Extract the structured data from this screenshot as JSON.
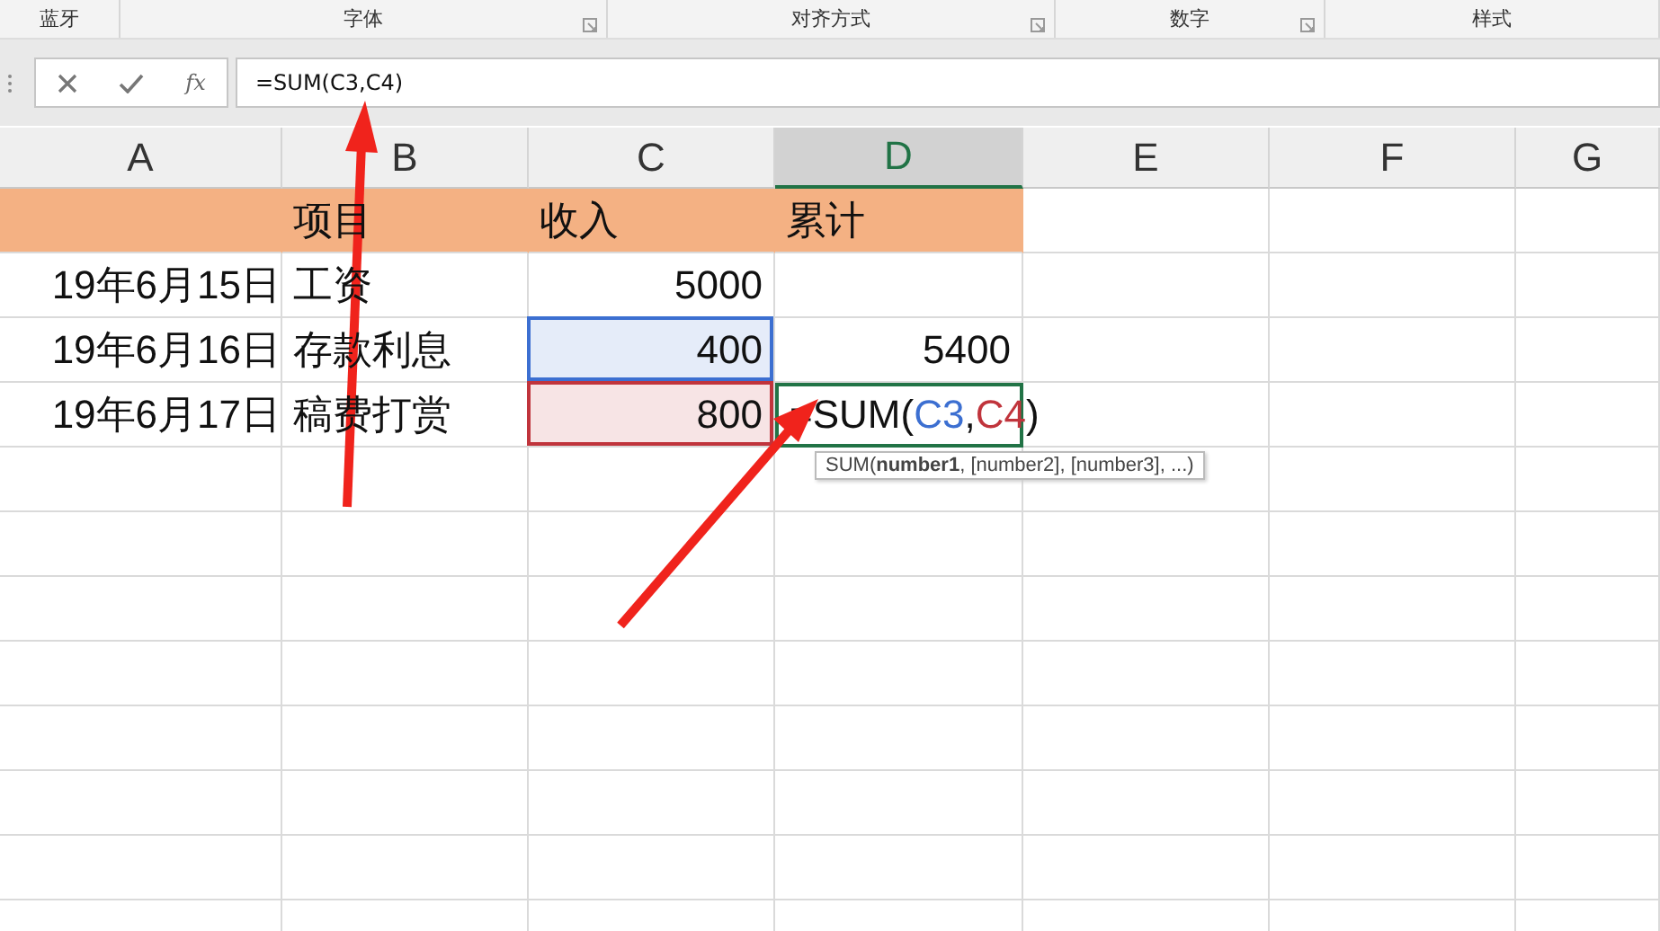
{
  "ribbon_groups": [
    {
      "label": "蓝牙",
      "launcher": false
    },
    {
      "label": "字体",
      "launcher": true
    },
    {
      "label": "对齐方式",
      "launcher": true
    },
    {
      "label": "数字",
      "launcher": true
    },
    {
      "label": "样式",
      "launcher": false
    }
  ],
  "formula_bar": {
    "value": "=SUM(C3,C4)",
    "fx": "fx"
  },
  "columns": [
    {
      "label": "A",
      "selected": false
    },
    {
      "label": "B",
      "selected": false
    },
    {
      "label": "C",
      "selected": false
    },
    {
      "label": "D",
      "selected": true
    },
    {
      "label": "E",
      "selected": false
    },
    {
      "label": "F",
      "selected": false
    },
    {
      "label": "G",
      "selected": false
    }
  ],
  "rows": [
    {
      "kind": "header",
      "cells": [
        {
          "text": ""
        },
        {
          "text": "项目"
        },
        {
          "text": "收入"
        },
        {
          "text": "累计"
        }
      ]
    },
    {
      "kind": "data",
      "cells": [
        {
          "text": "19年6月15日"
        },
        {
          "text": "工资"
        },
        {
          "text": "5000"
        },
        {
          "text": ""
        }
      ]
    },
    {
      "kind": "data",
      "cells": [
        {
          "text": "19年6月16日"
        },
        {
          "text": "存款利息"
        },
        {
          "text": "400",
          "color": "#3c6fd1"
        },
        {
          "text": "5400"
        }
      ]
    },
    {
      "kind": "data",
      "cells": [
        {
          "text": "19年6月17日"
        },
        {
          "text": "稿费打赏"
        },
        {
          "text": "800",
          "color": "#c0343c"
        },
        {
          "kind": "formula",
          "parts": [
            {
              "text": "=SUM("
            },
            {
              "text": "C3",
              "color": "#3c6fd1"
            },
            {
              "text": ","
            },
            {
              "text": "C4",
              "color": "#c0343c"
            },
            {
              "text": ")"
            }
          ]
        }
      ]
    }
  ],
  "tooltip": "SUM(**number1**, [number2], [number3], ...)"
}
